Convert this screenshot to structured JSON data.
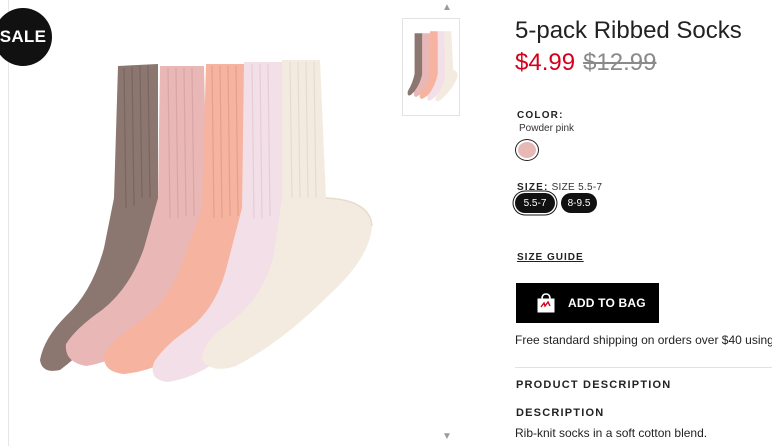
{
  "badge": {
    "sale": "SALE"
  },
  "product": {
    "title": "5-pack Ribbed Socks",
    "price": "$4.99",
    "original_price": "$12.99"
  },
  "color": {
    "label": "COLOR:",
    "value": "Powder pink",
    "swatch_hex": "#e8b8b4"
  },
  "size": {
    "label": "SIZE:",
    "selected": "SIZE 5.5-7",
    "options": [
      "5.5-7",
      "8-9.5"
    ]
  },
  "size_guide": "SIZE GUIDE",
  "add_to_bag": {
    "label": "ADD TO BAG",
    "icon": "shopping-bag-icon"
  },
  "shipping": "Free standard shipping on orders over $40 using",
  "product_description": {
    "heading": "PRODUCT DESCRIPTION"
  },
  "description": {
    "heading": "DESCRIPTION",
    "text": "Rib-knit socks in a soft cotton blend."
  },
  "colors": {
    "sale_price": "#d6001c",
    "button": "#000000",
    "socks": [
      "#8c7670",
      "#e9b7b6",
      "#f6b3a0",
      "#f3dfe8",
      "#f3ebe0"
    ]
  }
}
